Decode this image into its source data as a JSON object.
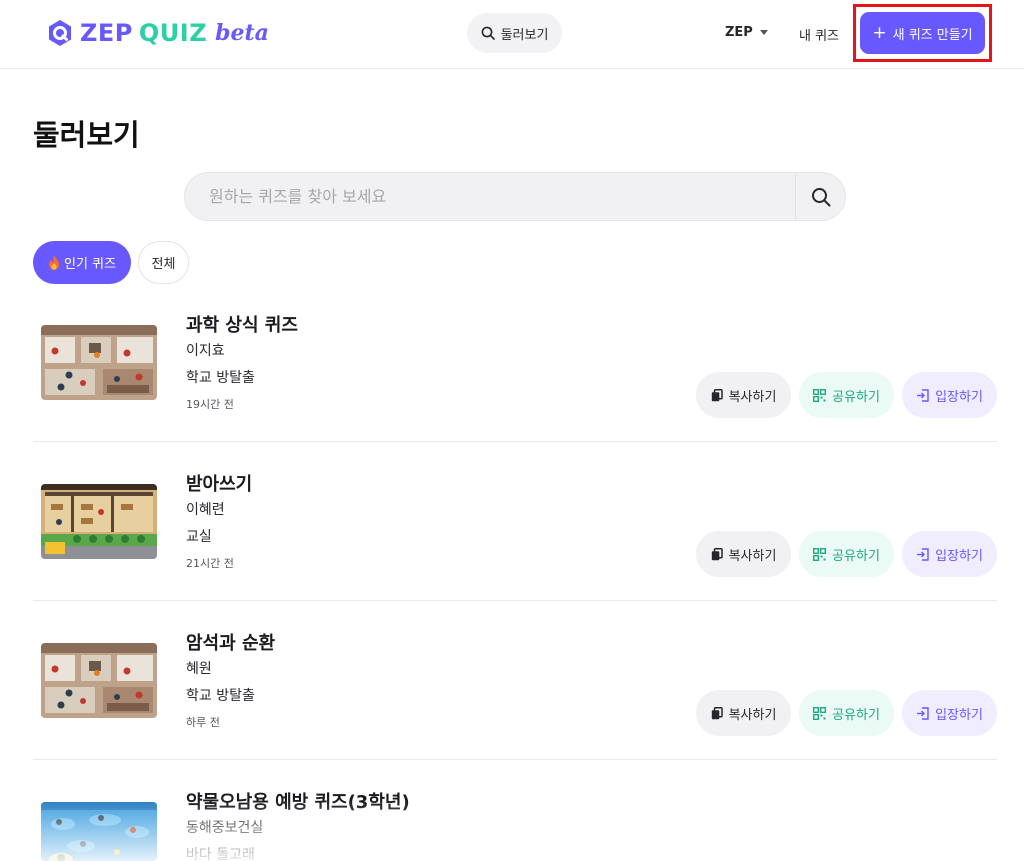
{
  "header": {
    "logo": {
      "zep": "ZEP",
      "quiz": "QUIZ",
      "beta": "beta"
    },
    "browse_label": "둘러보기",
    "zep_menu_label": "ZEP",
    "my_quiz_label": "내 퀴즈",
    "new_quiz_label": "새 퀴즈 만들기"
  },
  "page": {
    "title": "둘러보기"
  },
  "search": {
    "placeholder": "원하는 퀴즈를 찾아 보세요"
  },
  "filters": {
    "popular_label": "인기 퀴즈",
    "all_label": "전체",
    "active": "popular"
  },
  "quiz_actions": {
    "copy": "복사하기",
    "share": "공유하기",
    "enter": "입장하기"
  },
  "quizzes": [
    {
      "title": "과학 상식 퀴즈",
      "author": "이지효",
      "map": "학교 방탈출",
      "time": "19시간 전",
      "thumbnail": "school-escape-map"
    },
    {
      "title": "받아쓰기",
      "author": "이혜련",
      "map": "교실",
      "time": "21시간 전",
      "thumbnail": "classroom-map"
    },
    {
      "title": "암석과 순환",
      "author": "혜원",
      "map": "학교 방탈출",
      "time": "하루 전",
      "thumbnail": "school-escape-map"
    },
    {
      "title": "약물오남용 예방 퀴즈(3학년)",
      "author": "동해중보건실",
      "map": "바다 돌고래",
      "time": "",
      "thumbnail": "ocean-dolphin-map"
    }
  ],
  "colors": {
    "brand": "#6758ff",
    "accent_green": "#2dcfa6",
    "highlight_border": "#e5141b"
  }
}
